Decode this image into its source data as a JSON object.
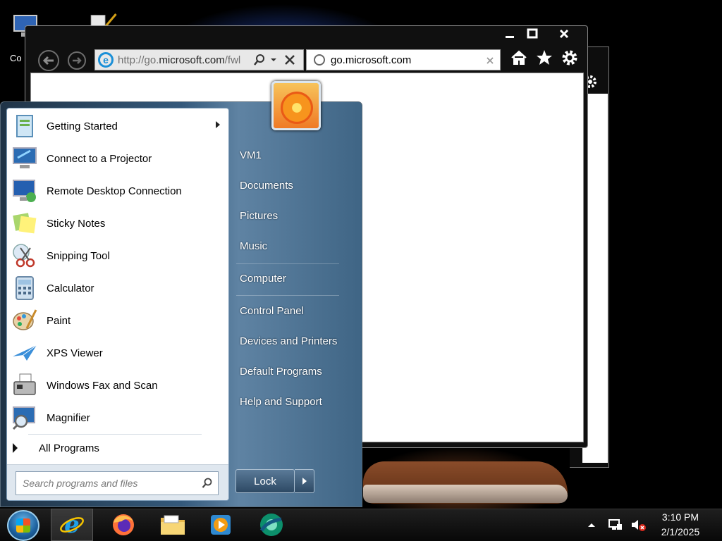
{
  "desktop": {
    "icons": [
      {
        "label": "Co"
      }
    ]
  },
  "browser": {
    "back_icon": "back-arrow-icon",
    "forward_icon": "forward-arrow-icon",
    "address_url_prefix": "http://go.",
    "address_url_domain": "microsoft.com",
    "address_url_suffix": "/fwl",
    "tab_title": "go.microsoft.com",
    "tool_icons": [
      "home-icon",
      "favorites-star-icon",
      "settings-gear-icon"
    ]
  },
  "start_menu": {
    "programs": [
      {
        "label": "Getting Started",
        "icon": "getting-started-icon",
        "has_submenu": true
      },
      {
        "label": "Connect to a Projector",
        "icon": "projector-icon"
      },
      {
        "label": "Remote Desktop Connection",
        "icon": "remote-desktop-icon"
      },
      {
        "label": "Sticky Notes",
        "icon": "sticky-notes-icon"
      },
      {
        "label": "Snipping Tool",
        "icon": "snipping-tool-icon"
      },
      {
        "label": "Calculator",
        "icon": "calculator-icon"
      },
      {
        "label": "Paint",
        "icon": "paint-icon"
      },
      {
        "label": "XPS Viewer",
        "icon": "xps-viewer-icon"
      },
      {
        "label": "Windows Fax and Scan",
        "icon": "fax-scan-icon"
      },
      {
        "label": "Magnifier",
        "icon": "magnifier-icon"
      }
    ],
    "all_programs": "All Programs",
    "search_placeholder": "Search programs and files",
    "right_items": [
      "VM1",
      "Documents",
      "Pictures",
      "Music",
      "Computer",
      "Control Panel",
      "Devices and Printers",
      "Default Programs",
      "Help and Support"
    ],
    "lock_label": "Lock"
  },
  "taskbar": {
    "pinned": [
      "internet-explorer-icon",
      "firefox-icon",
      "file-explorer-icon",
      "media-player-icon",
      "chrome-style-browser-icon"
    ],
    "time": "3:10 PM",
    "date": "2/1/2025"
  }
}
